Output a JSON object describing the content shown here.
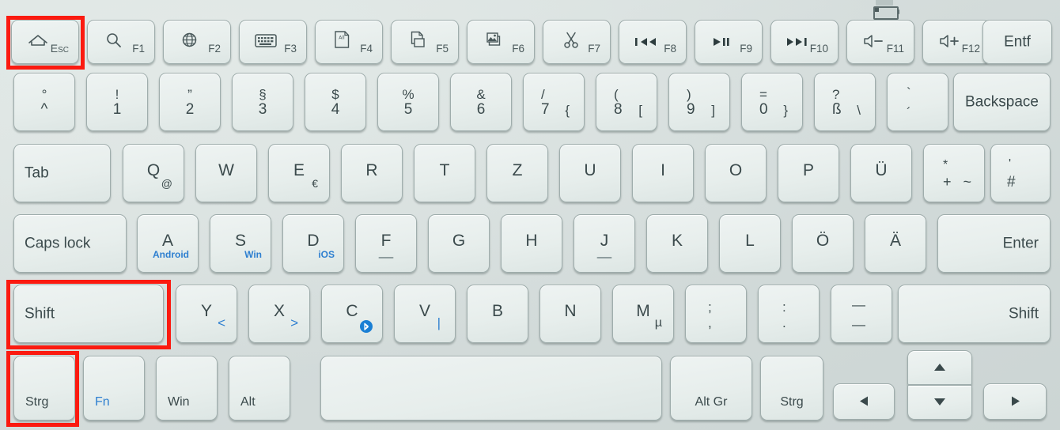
{
  "device": {
    "name": "wireless-keyboard",
    "layout": "German QWERTZ",
    "key_color": "#e8eeec",
    "case_color": "#d7dfdd",
    "accent_blue": "#2e7fd0",
    "highlight_color": "#fb1a10"
  },
  "status_icons": [
    {
      "name": "battery-icon",
      "label": "battery"
    }
  ],
  "highlights": [
    {
      "name": "esc-highlight",
      "target": "Esc"
    },
    {
      "name": "shift-highlight",
      "target": "Shift"
    },
    {
      "name": "strg-highlight",
      "target": "Strg"
    }
  ],
  "rows": [
    {
      "name": "function-row",
      "keys": [
        {
          "name": "key-esc",
          "icon": "home-icon",
          "legend": "Esc",
          "style": "fn"
        },
        {
          "name": "key-f1",
          "icon": "search-icon",
          "legend": "F1",
          "style": "fn"
        },
        {
          "name": "key-f2",
          "icon": "globe-icon",
          "legend": "F2",
          "style": "fn"
        },
        {
          "name": "key-f3",
          "icon": "keyboard-icon",
          "legend": "F3",
          "style": "fn"
        },
        {
          "name": "key-f4",
          "icon": "select-all-icon",
          "legend": "F4",
          "style": "fn"
        },
        {
          "name": "key-f5",
          "icon": "copy-icon",
          "legend": "F5",
          "style": "fn"
        },
        {
          "name": "key-f6",
          "icon": "paste-image-icon",
          "legend": "F6",
          "style": "fn"
        },
        {
          "name": "key-f7",
          "icon": "scissors-icon",
          "legend": "F7",
          "style": "fn"
        },
        {
          "name": "key-f8",
          "icon": "previous-track-icon",
          "legend": "F8",
          "style": "fn"
        },
        {
          "name": "key-f9",
          "icon": "play-pause-icon",
          "legend": "F9",
          "style": "fn"
        },
        {
          "name": "key-f10",
          "icon": "next-track-icon",
          "legend": "F10",
          "style": "fn"
        },
        {
          "name": "key-f11",
          "icon": "volume-down-icon",
          "legend": "F11",
          "style": "fn"
        },
        {
          "name": "key-f12",
          "icon": "volume-up-icon",
          "legend": "F12",
          "style": "fn"
        },
        {
          "name": "key-entf",
          "legend": "Entf",
          "style": "word"
        }
      ]
    },
    {
      "name": "number-row",
      "keys": [
        {
          "name": "key-circumflex",
          "top": "°",
          "main": "^"
        },
        {
          "name": "key-1",
          "top": "!",
          "main": "1"
        },
        {
          "name": "key-2",
          "top": "”",
          "main": "2"
        },
        {
          "name": "key-3",
          "top": "§",
          "main": "3"
        },
        {
          "name": "key-4",
          "top": "$",
          "main": "4"
        },
        {
          "name": "key-5",
          "top": "%",
          "main": "5"
        },
        {
          "name": "key-6",
          "top": "&",
          "main": "6"
        },
        {
          "name": "key-7",
          "top": "/",
          "main": "7",
          "alt": "{"
        },
        {
          "name": "key-8",
          "top": "(",
          "main": "8",
          "alt": "["
        },
        {
          "name": "key-9",
          "top": ")",
          "main": "9",
          "alt": "]"
        },
        {
          "name": "key-0",
          "top": "=",
          "main": "0",
          "alt": "}"
        },
        {
          "name": "key-eszett",
          "top": "?",
          "main": "ß",
          "alt": "\\"
        },
        {
          "name": "key-acute",
          "top": "`",
          "main": "´"
        },
        {
          "name": "key-backspace",
          "legend": "Backspace",
          "style": "word-right"
        }
      ]
    },
    {
      "name": "qwertz-row",
      "keys": [
        {
          "name": "key-tab",
          "legend": "Tab",
          "style": "word-left"
        },
        {
          "name": "key-q",
          "main": "Q",
          "sub": "@"
        },
        {
          "name": "key-w",
          "main": "W"
        },
        {
          "name": "key-e",
          "main": "E",
          "sub": "€"
        },
        {
          "name": "key-r",
          "main": "R"
        },
        {
          "name": "key-t",
          "main": "T"
        },
        {
          "name": "key-z",
          "main": "Z"
        },
        {
          "name": "key-u",
          "main": "U"
        },
        {
          "name": "key-i",
          "main": "I"
        },
        {
          "name": "key-o",
          "main": "O"
        },
        {
          "name": "key-p",
          "main": "P"
        },
        {
          "name": "key-uumlaut",
          "main": "Ü"
        },
        {
          "name": "key-plus",
          "top": "*",
          "main": "+",
          "alt": "~"
        },
        {
          "name": "key-hash",
          "top": "'",
          "main": "#"
        }
      ]
    },
    {
      "name": "home-row",
      "keys": [
        {
          "name": "key-caps-lock",
          "legend": "Caps lock",
          "style": "word-left"
        },
        {
          "name": "key-a",
          "main": "A",
          "sub_blue": "Android"
        },
        {
          "name": "key-s",
          "main": "S",
          "sub_blue": "Win"
        },
        {
          "name": "key-d",
          "main": "D",
          "sub_blue": "iOS"
        },
        {
          "name": "key-f",
          "main": "F",
          "homing": true
        },
        {
          "name": "key-g",
          "main": "G"
        },
        {
          "name": "key-h",
          "main": "H"
        },
        {
          "name": "key-j",
          "main": "J",
          "homing": true
        },
        {
          "name": "key-k",
          "main": "K"
        },
        {
          "name": "key-l",
          "main": "L"
        },
        {
          "name": "key-oumlaut",
          "main": "Ö"
        },
        {
          "name": "key-aumlaut",
          "main": "Ä"
        },
        {
          "name": "key-enter",
          "legend": "Enter",
          "style": "word-right"
        }
      ]
    },
    {
      "name": "shift-row",
      "keys": [
        {
          "name": "key-shift-left",
          "legend": "Shift",
          "style": "word-left"
        },
        {
          "name": "key-y",
          "main": "Y",
          "sub_blue_sym": "<"
        },
        {
          "name": "key-x",
          "main": "X",
          "sub_blue_sym": ">"
        },
        {
          "name": "key-c",
          "main": "C",
          "icon_sub": "bluetooth-icon"
        },
        {
          "name": "key-v",
          "main": "V",
          "sub_blue_sym": "|"
        },
        {
          "name": "key-b",
          "main": "B"
        },
        {
          "name": "key-n",
          "main": "N"
        },
        {
          "name": "key-m",
          "main": "M",
          "sub": "µ"
        },
        {
          "name": "key-semicolon",
          "top": ";",
          "main": ","
        },
        {
          "name": "key-colon",
          "top": ":",
          "main": "."
        },
        {
          "name": "key-underscore",
          "top": "—",
          "main": "—"
        },
        {
          "name": "key-shift-right",
          "legend": "Shift",
          "style": "word-right"
        }
      ]
    },
    {
      "name": "modifier-row",
      "keys": [
        {
          "name": "key-strg-left",
          "legend": "Strg",
          "style": "corner"
        },
        {
          "name": "key-fn",
          "legend": "Fn",
          "style": "corner",
          "blue": true
        },
        {
          "name": "key-win",
          "legend": "Win",
          "style": "corner"
        },
        {
          "name": "key-alt",
          "legend": "Alt",
          "style": "corner"
        },
        {
          "name": "key-space",
          "legend": "",
          "style": "space"
        },
        {
          "name": "key-alt-gr",
          "legend": "Alt Gr",
          "style": "corner-center"
        },
        {
          "name": "key-strg-right",
          "legend": "Strg",
          "style": "corner-center"
        },
        {
          "name": "key-arrow-left",
          "icon": "arrow-left-icon"
        },
        {
          "name": "key-arrow-up",
          "icon": "arrow-up-icon"
        },
        {
          "name": "key-arrow-down",
          "icon": "arrow-down-icon"
        },
        {
          "name": "key-arrow-right",
          "icon": "arrow-right-icon"
        }
      ]
    }
  ]
}
